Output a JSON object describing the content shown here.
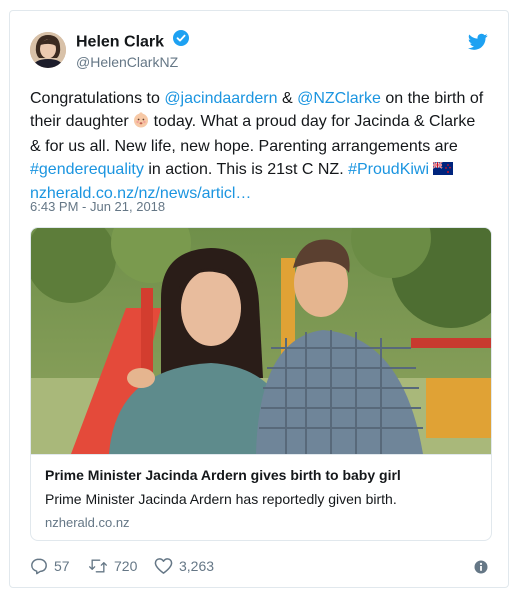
{
  "author": {
    "name": "Helen Clark",
    "handle": "@HelenClarkNZ"
  },
  "tweet": {
    "t1": "Congratulations to ",
    "mention1": "@jacindaardern",
    "t2": " & ",
    "mention2": "@NZClarke",
    "t3": " on the birth of their daughter ",
    "t4": " today. What a proud day for Jacinda & Clarke & for us all. New life, new hope. Parenting arrangements are ",
    "hashtag1": "#genderequality",
    "t5": " in action. This is 21st C NZ. ",
    "hashtag2": "#ProudKiwi",
    "link": "nzherald.co.nz/nz/news/articl…",
    "timestamp": "6:43 PM - Jun 21, 2018"
  },
  "card": {
    "title": "Prime Minister Jacinda Ardern gives birth to baby girl",
    "description": "Prime Minister Jacinda Ardern has reportedly given birth.",
    "domain": "nzherald.co.nz"
  },
  "actions": {
    "replies": "57",
    "retweets": "720",
    "likes": "3,263"
  },
  "colors": {
    "link": "#1b95e0",
    "muted": "#657786",
    "border": "#e1e8ed",
    "twitter_blue": "#1da1f2"
  },
  "icons": [
    "verified-badge-icon",
    "twitter-bird-icon",
    "baby-emoji-icon",
    "nz-flag-emoji-icon",
    "reply-icon",
    "retweet-icon",
    "heart-icon",
    "info-icon"
  ]
}
